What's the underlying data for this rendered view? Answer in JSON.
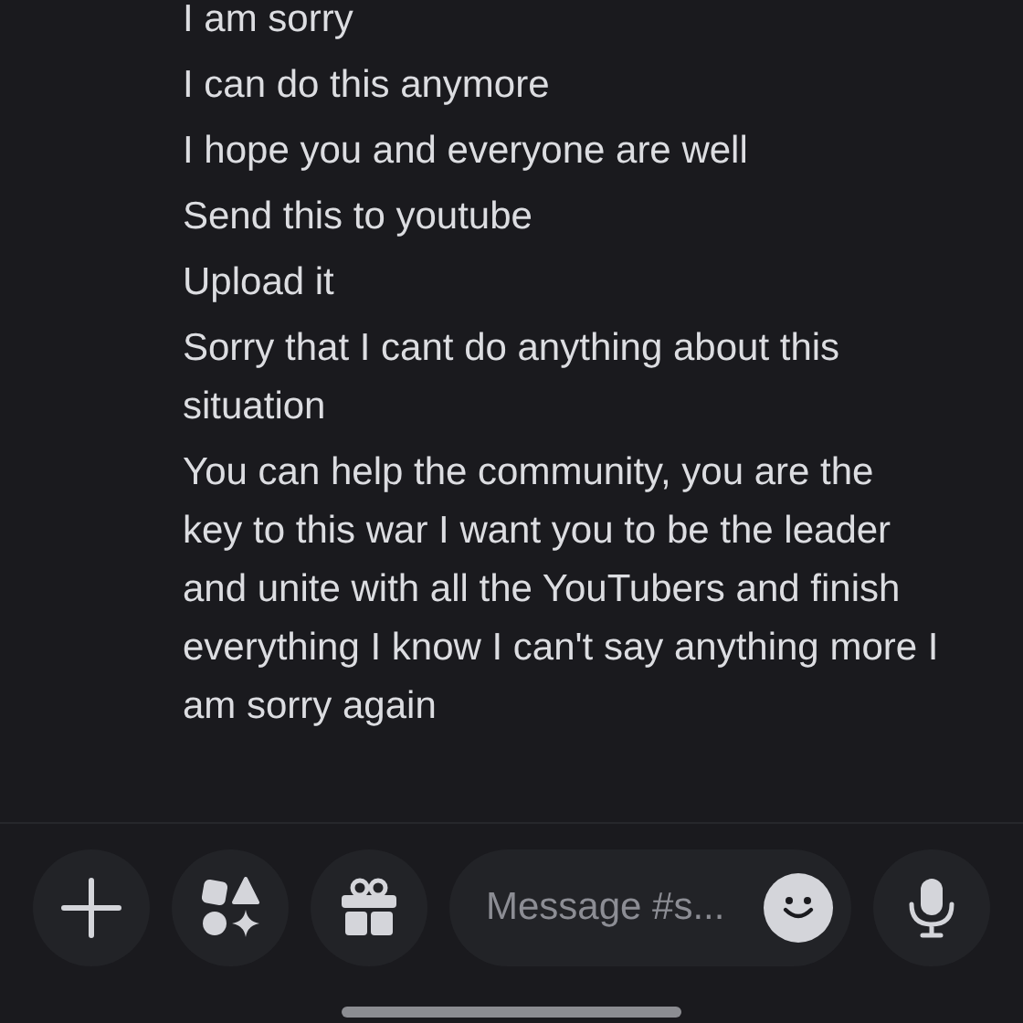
{
  "messages": [
    "I am sorry",
    "I can do this anymore",
    "I hope you and everyone are well",
    "Send this to youtube",
    "Upload it",
    "Sorry that I cant do anything about this situation",
    "You can help the community, you are the key to this war I want you to be the leader and unite with all the YouTubers and finish everything I know I can't say anything more I am sorry again"
  ],
  "composer": {
    "placeholder": "Message #s..."
  }
}
